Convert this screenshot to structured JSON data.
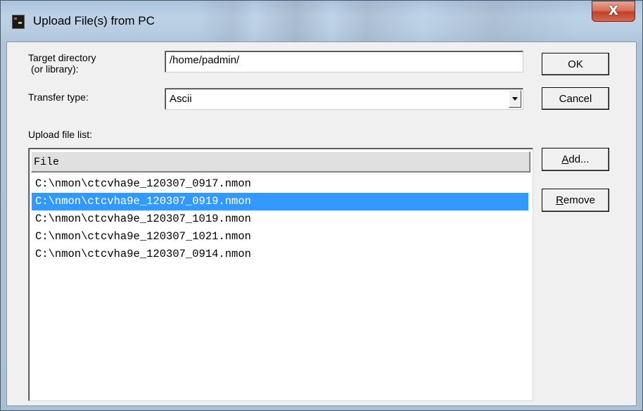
{
  "window": {
    "title": "Upload File(s) from PC",
    "close_label": "X"
  },
  "form": {
    "target_label_line1": "Target directory",
    "target_label_line2": "(or library):",
    "target_value": "/home/padmin/",
    "transfer_label": "Transfer type:",
    "transfer_value": "Ascii",
    "upload_list_label": "Upload file list:"
  },
  "buttons": {
    "ok": "OK",
    "cancel": "Cancel",
    "add_prefix": "A",
    "add_rest": "dd...",
    "remove_prefix": "R",
    "remove_rest": "emove"
  },
  "file_list": {
    "column_header": "File",
    "selected_index": 1,
    "rows": [
      "C:\\nmon\\ctcvha9e_120307_0917.nmon",
      "C:\\nmon\\ctcvha9e_120307_0919.nmon",
      "C:\\nmon\\ctcvha9e_120307_1019.nmon",
      "C:\\nmon\\ctcvha9e_120307_1021.nmon",
      "C:\\nmon\\ctcvha9e_120307_0914.nmon"
    ]
  },
  "icons": {
    "app": "nmon-app-icon",
    "close": "close-icon",
    "dropdown": "chevron-down-icon"
  },
  "colors": {
    "selection": "#3399ff",
    "close_button": "#c1412a",
    "dialog_background": "#f0f0f0"
  }
}
